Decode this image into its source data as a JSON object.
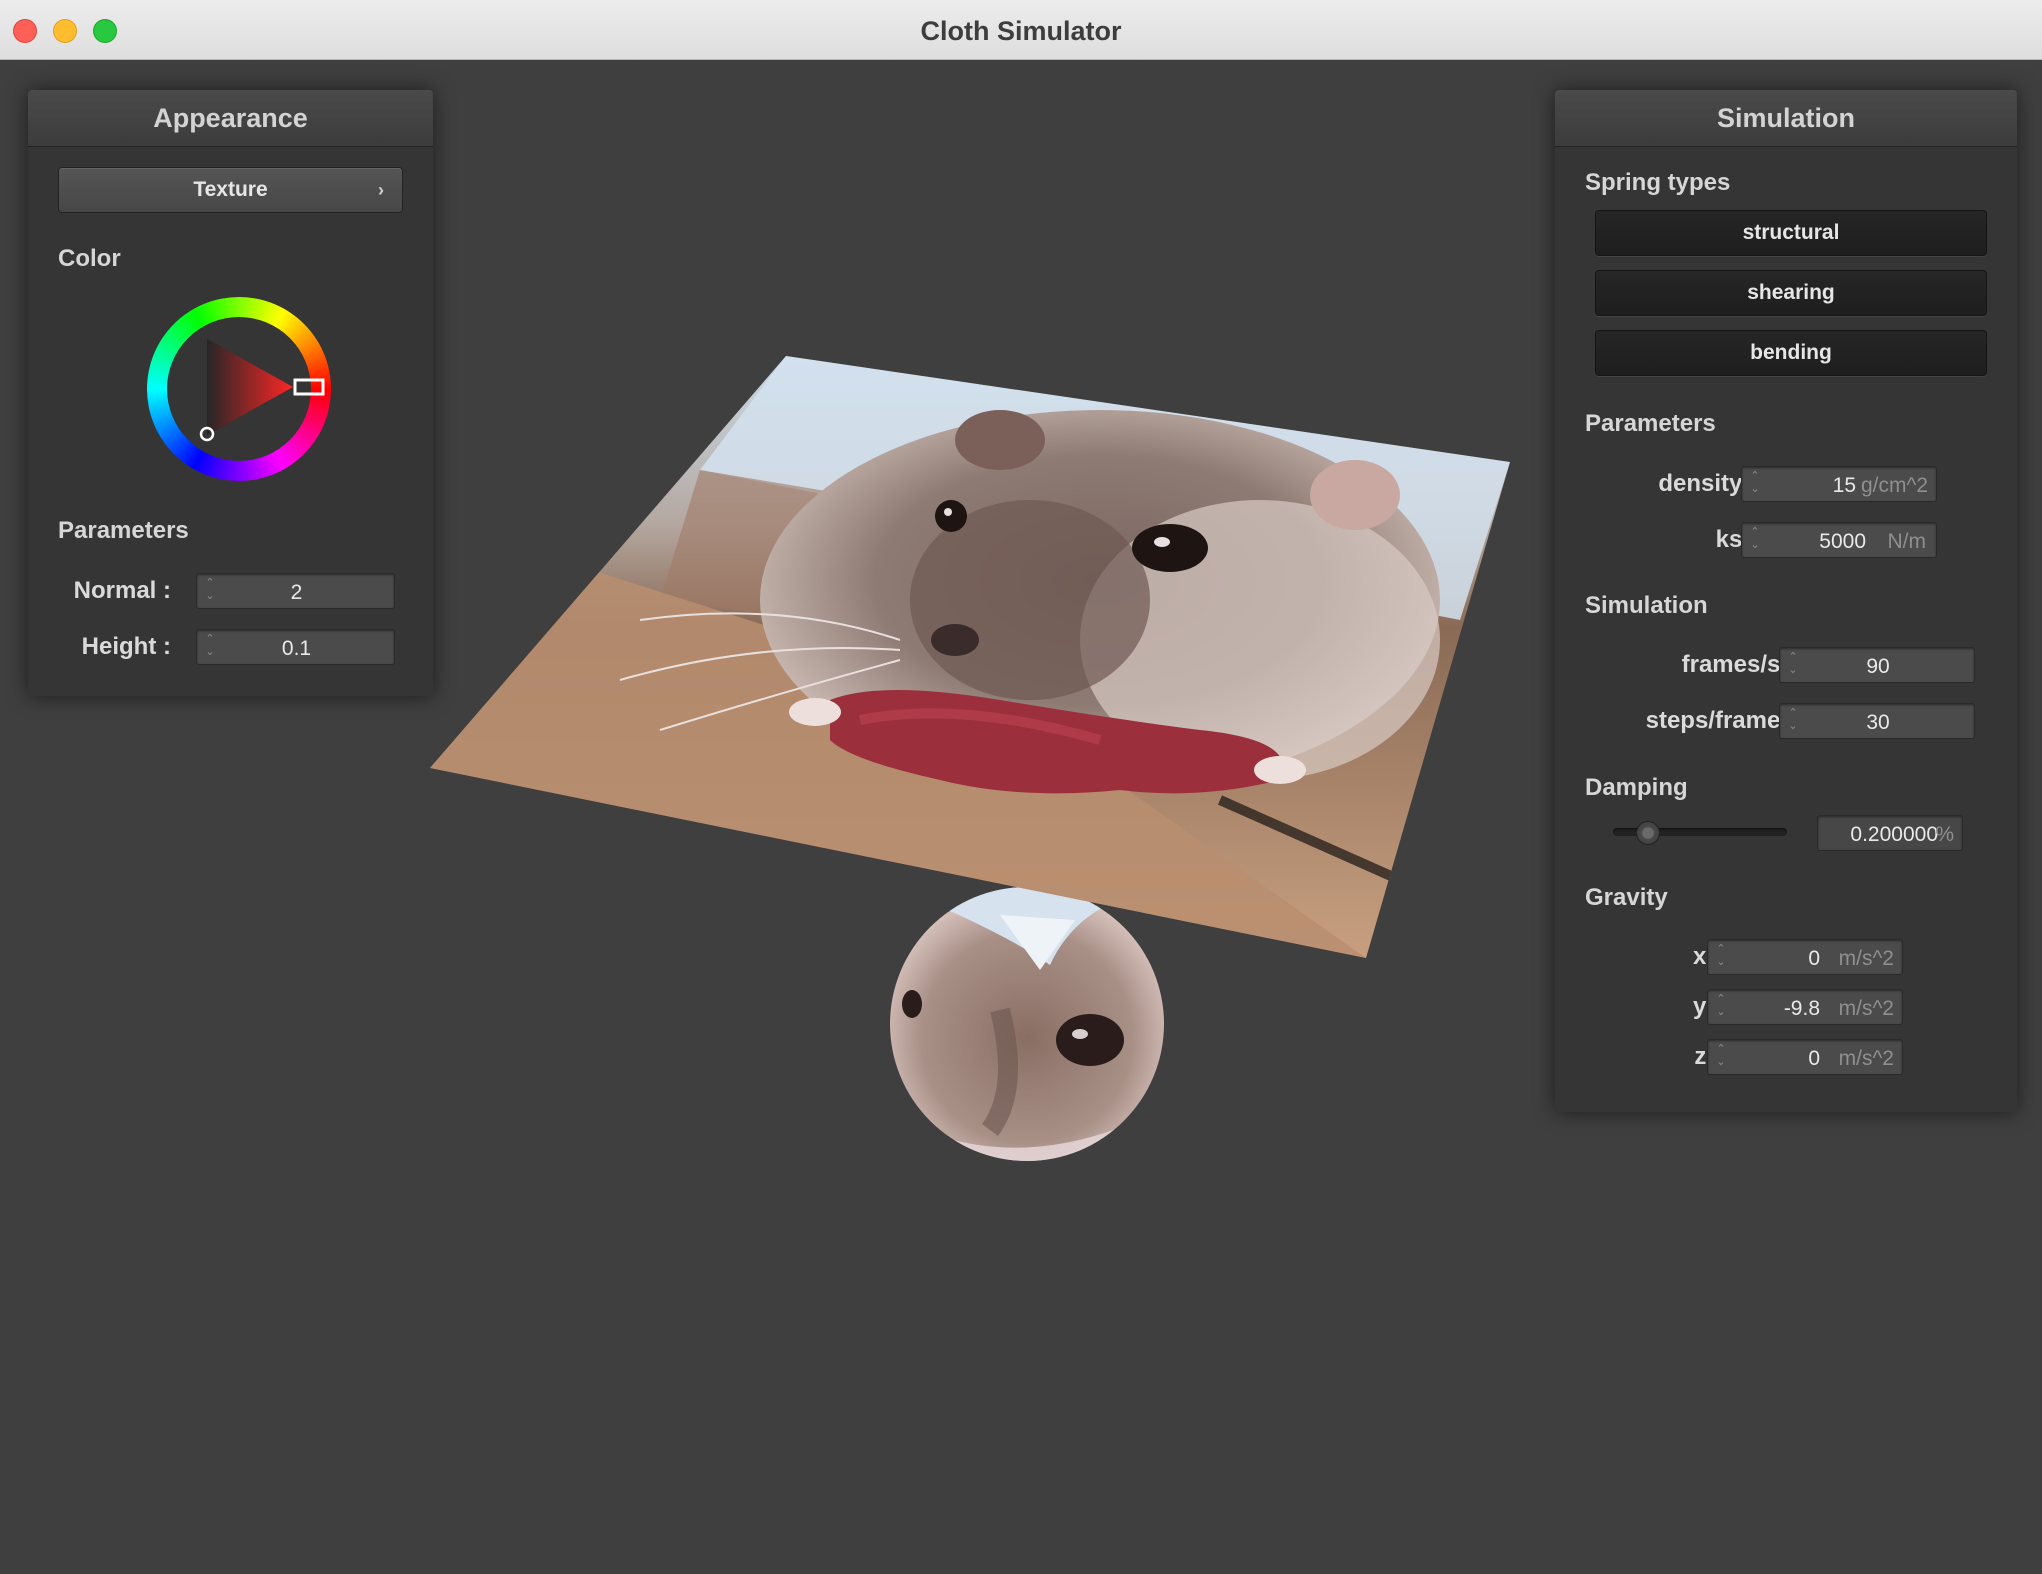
{
  "window": {
    "title": "Cloth Simulator"
  },
  "appearance": {
    "title": "Appearance",
    "texture_label": "Texture",
    "texture_chevron": "›",
    "color_label": "Color",
    "selected_color": "#ff0000",
    "parameters_label": "Parameters",
    "normal": {
      "label": "Normal :",
      "value": "2"
    },
    "height": {
      "label": "Height :",
      "value": "0.1"
    }
  },
  "simulation": {
    "title": "Simulation",
    "spring_types_label": "Spring types",
    "springs": [
      "structural",
      "shearing",
      "bending"
    ],
    "parameters_label": "Parameters",
    "density": {
      "label": "density :",
      "value": "15",
      "unit": "g/cm^2"
    },
    "ks": {
      "label": "ks :",
      "value": "5000",
      "unit": "N/m"
    },
    "simulation_label": "Simulation",
    "fps": {
      "label": "frames/s :",
      "value": "90"
    },
    "steps": {
      "label": "steps/frame :",
      "value": "30"
    },
    "damping_label": "Damping",
    "damping": {
      "value": "0.200000",
      "unit": "%",
      "slider_fraction": 0.2
    },
    "gravity_label": "Gravity",
    "gravity": [
      {
        "label": "x :",
        "value": "0",
        "unit": "m/s^2"
      },
      {
        "label": "y :",
        "value": "-9.8",
        "unit": "m/s^2"
      },
      {
        "label": "z :",
        "value": "0",
        "unit": "m/s^2"
      }
    ]
  },
  "scene": {
    "cloth_texture": "hamster-photo",
    "sphere_texture": "hamster-photo"
  }
}
